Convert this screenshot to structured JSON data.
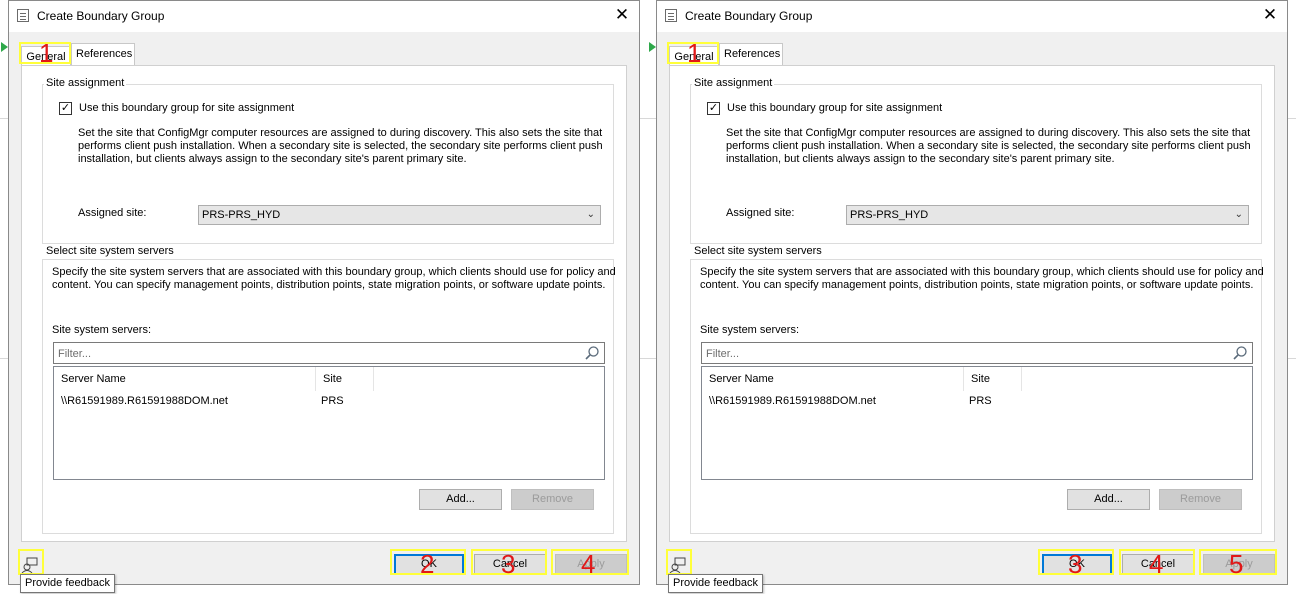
{
  "panels": [
    {
      "window_title": "Create Boundary Group",
      "tabs": [
        {
          "label": "General"
        },
        {
          "label": "References"
        }
      ],
      "site_assignment": {
        "group_label": "Site assignment",
        "checkbox_label": "Use this boundary group for site assignment",
        "checked": true,
        "description_lines": [
          "Set the site that ConfigMgr computer resources are assigned to during discovery. This also sets the site that",
          "performs client push installation. When a secondary site is selected, the secondary site performs client push",
          "installation, but clients always assign to the secondary site's parent primary site."
        ],
        "assigned_site_label": "Assigned site:",
        "assigned_site_value": "PRS-PRS_HYD"
      },
      "site_servers": {
        "group_label": "Select site system servers",
        "description_lines": [
          "Specify the site system servers that are associated with this boundary group, which clients should use for policy and",
          "content. You can specify management points, distribution points, state migration points, or software update points."
        ],
        "list_label": "Site system servers:",
        "filter_placeholder": "Filter...",
        "columns": [
          "Server Name",
          "Site"
        ],
        "rows": [
          {
            "server": "\\\\R61591989.R61591988DOM.net",
            "site": "PRS"
          }
        ],
        "add_label": "Add...",
        "remove_label": "Remove"
      },
      "footer": {
        "ok_label": "OK",
        "cancel_label": "Cancel",
        "apply_label": "Apply",
        "feedback_tooltip": "Provide feedback"
      },
      "annotations": {
        "tab_marker": "1",
        "ok_marker": "2",
        "cancel_marker": "3",
        "apply_marker": "4"
      }
    },
    {
      "window_title": "Create Boundary Group",
      "tabs": [
        {
          "label": "General"
        },
        {
          "label": "References"
        }
      ],
      "site_assignment": {
        "group_label": "Site assignment",
        "checkbox_label": "Use this boundary group for site assignment",
        "checked": true,
        "description_lines": [
          "Set the site that ConfigMgr computer resources are assigned to during discovery. This also sets the site that",
          "performs client push installation. When a secondary site is selected, the secondary site performs client push",
          "installation, but clients always assign to the secondary site's parent primary site."
        ],
        "assigned_site_label": "Assigned site:",
        "assigned_site_value": "PRS-PRS_HYD"
      },
      "site_servers": {
        "group_label": "Select site system servers",
        "description_lines": [
          "Specify the site system servers that are associated with this boundary group, which clients should use for policy and",
          "content. You can specify management points, distribution points, state migration points, or software update points."
        ],
        "list_label": "Site system servers:",
        "filter_placeholder": "Filter...",
        "columns": [
          "Server Name",
          "Site"
        ],
        "rows": [
          {
            "server": "\\\\R61591989.R61591988DOM.net",
            "site": "PRS"
          }
        ],
        "add_label": "Add...",
        "remove_label": "Remove"
      },
      "footer": {
        "ok_label": "OK",
        "cancel_label": "Cancel",
        "apply_label": "Apply",
        "feedback_tooltip": "Provide feedback"
      },
      "annotations": {
        "tab_marker": "1",
        "ok_marker": "3",
        "cancel_marker": "4",
        "apply_marker": "5"
      }
    }
  ],
  "colors": {
    "highlight": "#ffff3a",
    "marker": "#e01818",
    "default_button_border": "#0078d7"
  }
}
